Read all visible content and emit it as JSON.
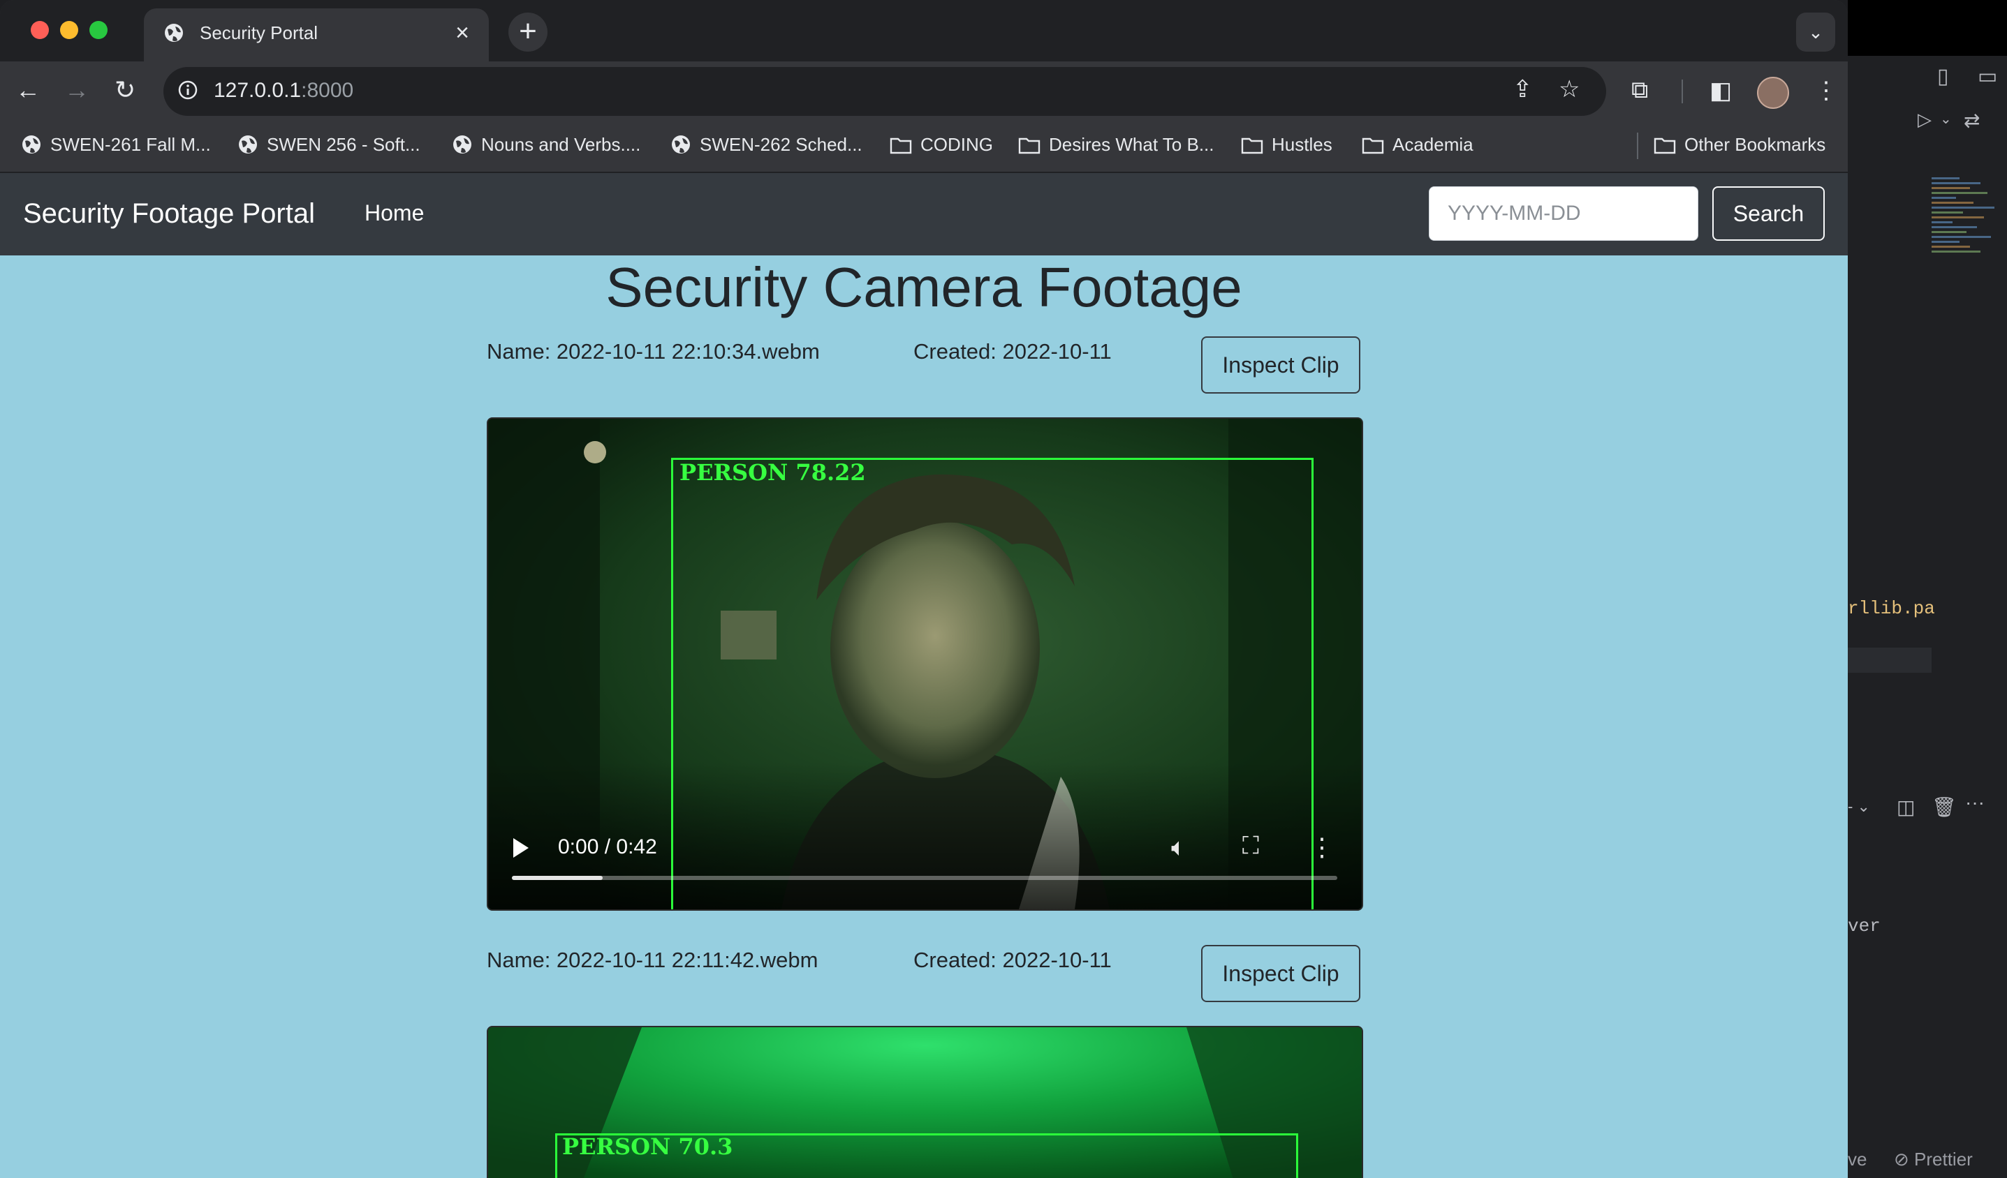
{
  "browser": {
    "tab_title": "Security Portal",
    "url_host": "127.0.0.1",
    "url_port": ":8000",
    "bookmarks": [
      {
        "label": "SWEN-261 Fall M...",
        "icon": "globe-icon"
      },
      {
        "label": "SWEN 256 - Soft...",
        "icon": "globe-icon"
      },
      {
        "label": "Nouns and Verbs....",
        "icon": "globe-icon"
      },
      {
        "label": "SWEN-262 Sched...",
        "icon": "globe-icon"
      },
      {
        "label": "CODING",
        "icon": "folder-icon"
      },
      {
        "label": "Desires What To B...",
        "icon": "folder-icon"
      },
      {
        "label": "Hustles",
        "icon": "folder-icon"
      },
      {
        "label": "Academia",
        "icon": "folder-icon"
      }
    ],
    "other_bookmarks": "Other Bookmarks"
  },
  "navbar": {
    "brand": "Security Footage Portal",
    "home": "Home",
    "search_placeholder": "YYYY-MM-DD",
    "search_button": "Search"
  },
  "page": {
    "title": "Security Camera Footage"
  },
  "clips": [
    {
      "name": "Name: 2022-10-11 22:10:34.webm",
      "created": "Created: 2022-10-11",
      "inspect": "Inspect Clip",
      "detection": "PERSON 78.22",
      "time": "0:00 / 0:42",
      "progress": 0.11
    },
    {
      "name": "Name: 2022-10-11 22:11:42.webm",
      "created": "Created: 2022-10-11",
      "inspect": "Inspect Clip",
      "detection": "PERSON 70.3"
    }
  ],
  "editor": {
    "code_fragment": "rllib.pa",
    "output_fragment": "ver",
    "status_left": "ve",
    "status_prettier": "Prettier"
  },
  "colors": {
    "page_bg": "#96cfe0",
    "navbar_bg": "#353a40",
    "detection_box": "#2bff3a"
  }
}
